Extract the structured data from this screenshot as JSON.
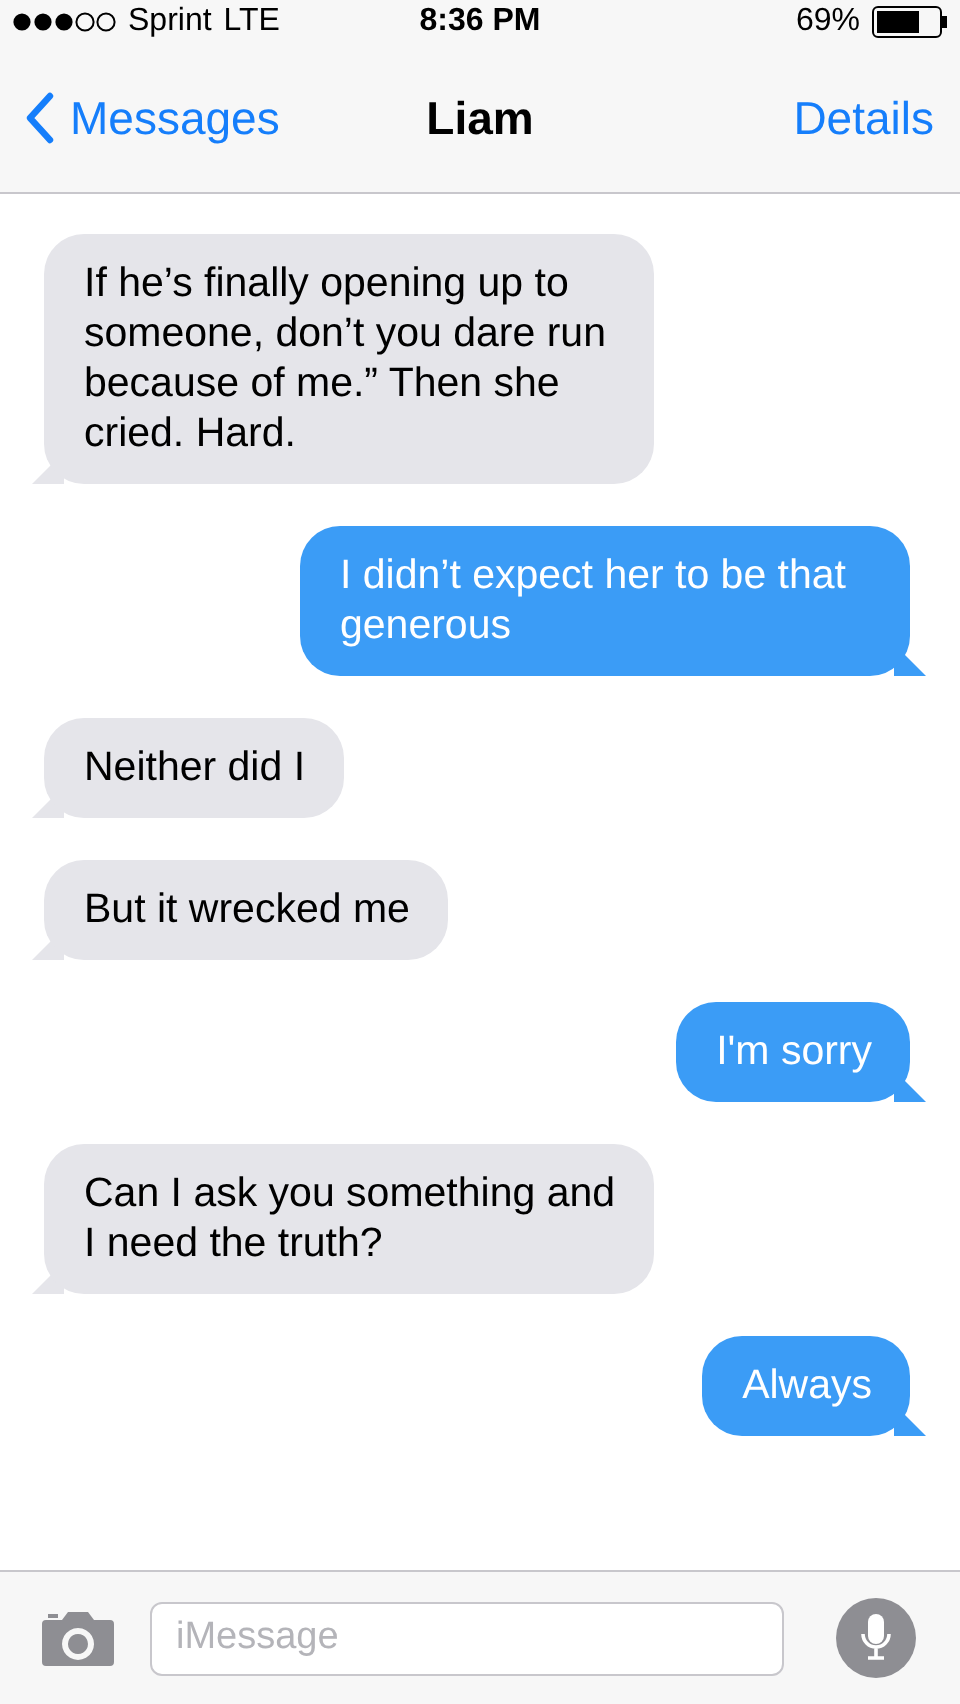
{
  "status_bar": {
    "carrier": "Sprint",
    "network": "LTE",
    "time": "8:36 PM",
    "battery": "69%"
  },
  "nav_bar": {
    "back": "Messages",
    "title": "Liam",
    "action": "Details"
  },
  "messages": [
    {
      "kind": "incoming",
      "text": "If he’s finally opening up to someone, don’t you dare run because of me.” Then she cried. Hard."
    },
    {
      "kind": "outgoing",
      "text": "I didn’t expect her to be that generous"
    },
    {
      "kind": "incoming",
      "text": "Neither did I"
    },
    {
      "kind": "incoming",
      "text": "But it wrecked me"
    },
    {
      "kind": "outgoing",
      "text": "I'm sorry"
    },
    {
      "kind": "incoming",
      "text": "Can I ask you something and I need the truth?"
    },
    {
      "kind": "outgoing",
      "text": "Always"
    }
  ],
  "input_bar": {
    "placeholder": "iMessage"
  }
}
